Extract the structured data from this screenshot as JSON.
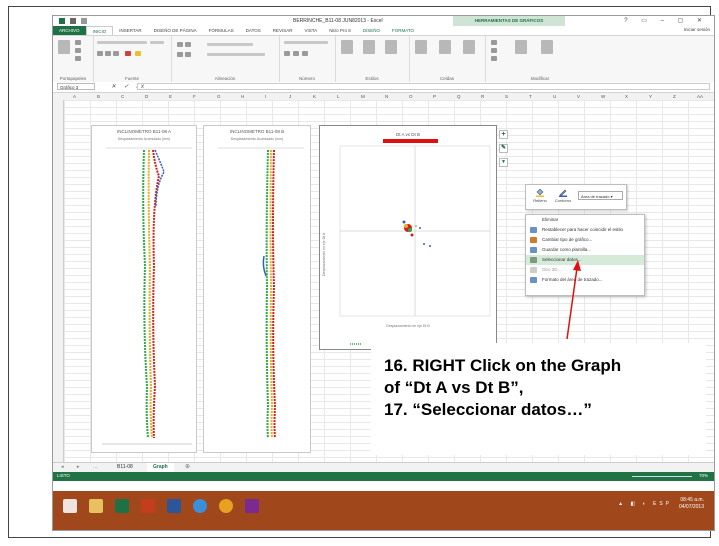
{
  "window": {
    "title": "BERRINCHE_B11-08 JUN82013 - Excel",
    "tools_banner": "HERRAMIENTAS DE GRÁFICOS",
    "controls": "? ▭ – ▢ ✕"
  },
  "ribbon": {
    "tabs": [
      "ARCHIVO",
      "INICIO",
      "INSERTAR",
      "DISEÑO DE PÁGINA",
      "FÓRMULAS",
      "DATOS",
      "REVISAR",
      "VISTA",
      "Nitro Pro 8",
      "DISEÑO",
      "FORMATO"
    ],
    "sign_in": "Iniciar sesión",
    "groups": [
      "Portapapeles",
      "Fuente",
      "Alineación",
      "Número",
      "Estilos",
      "Celdas",
      "Modificar"
    ]
  },
  "formula_bar": {
    "name_box": "Gráfico 3",
    "fx_label": "fx"
  },
  "columns": [
    "A",
    "B",
    "C",
    "D",
    "E",
    "F",
    "G",
    "H",
    "I",
    "J",
    "K",
    "L",
    "M",
    "N",
    "O",
    "P",
    "Q",
    "R",
    "S",
    "T",
    "U",
    "V",
    "W",
    "X",
    "Y",
    "Z",
    "AA"
  ],
  "charts": {
    "left": {
      "title": "INCLINOMETRO B11-08 A",
      "subtitle": "Desplazamiento Acumulado (mm)"
    },
    "middle": {
      "title": "INCLINOMETRO B11-08 B",
      "subtitle": "Desplazamiento Acumulado (mm)"
    },
    "right": {
      "title": "Dt A vs Dt B",
      "xlabel": "Desplazamiento en eje Dt B",
      "ylabel": "Desplazamiento en eje Dt A"
    }
  },
  "mini_toolbar": {
    "fill_label": "Relleno",
    "outline_label": "Contorno",
    "element_select": "Área de trazado"
  },
  "context_menu": {
    "items": [
      {
        "label": "Eliminar",
        "state": "normal"
      },
      {
        "label": "Restablecer para hacer coincidir el estilo",
        "state": "normal"
      },
      {
        "label": "Cambiar tipo de gráfico...",
        "state": "normal"
      },
      {
        "label": "Guardar como plantilla...",
        "state": "normal"
      },
      {
        "label": "Seleccionar datos...",
        "state": "highlighted"
      },
      {
        "label": "Giro 3D...",
        "state": "disabled"
      },
      {
        "label": "Formato del área de trazado...",
        "state": "normal"
      }
    ]
  },
  "annotation": {
    "line1": "16. RIGHT Click on the Graph",
    "line2": "of “Dt A vs Dt B”,",
    "line3": "17. “Seleccionar datos…”"
  },
  "sheets": {
    "tabs": [
      "B11-08",
      "Graph"
    ],
    "active": "Graph",
    "add": "⊕"
  },
  "status": {
    "left": "LISTO",
    "zoom": "70%"
  },
  "taskbar": {
    "clock_time": "08:45 a.m.",
    "clock_date": "04/07/2013",
    "tray": "▲ ◧ ◐ ESP"
  },
  "colors": {
    "excel_green": "#217346",
    "taskbar": "#a0481b",
    "annotation_red": "#e01010",
    "menu_highlight": "#d5ead9"
  }
}
